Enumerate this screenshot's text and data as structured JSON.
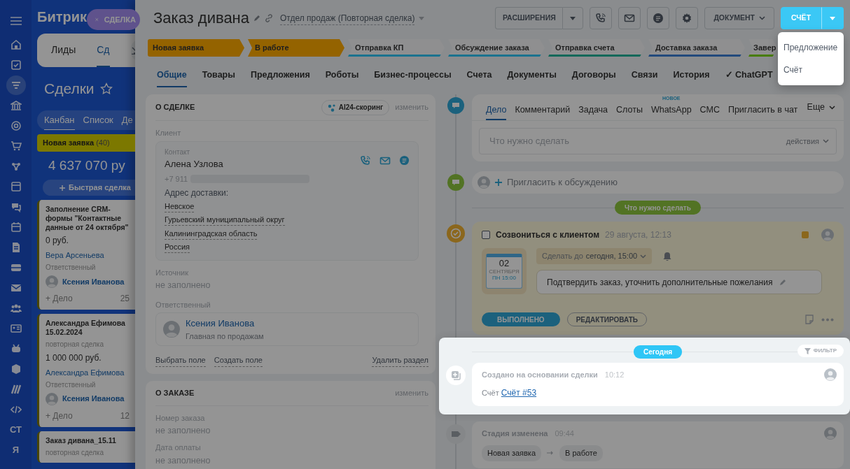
{
  "left_sidebar": {
    "labels": [
      "СТ",
      "Я"
    ]
  },
  "crm": {
    "logo": "Битрик",
    "nav_tabs": [
      {
        "label": "Лиды",
        "selected": false
      },
      {
        "label": "Сд",
        "selected": true
      }
    ],
    "page_title": "Сделки",
    "view_tabs": [
      {
        "label": "Канбан",
        "selected": true
      },
      {
        "label": "Список",
        "selected": false
      },
      {
        "label": "Де",
        "selected": false
      }
    ],
    "column": {
      "name": "Новая заявка",
      "count": "(40)",
      "color": "#7c7800",
      "total": "4 637 070 ру",
      "quick_add": "Быстрая сделка"
    },
    "cards": [
      {
        "title": "Заполнение CRM-формы \"Контактные данные от 24 октября\"",
        "amount": "0 руб.",
        "client": "Вера Арсеньева",
        "responsible_label": "Ответственный",
        "responsible": "Ксения Иванова",
        "add_task": "+ Дело",
        "meta": "25"
      },
      {
        "title": "Александра Ефимова 15.02.2024",
        "subtitle": "повторная сделка",
        "amount": "1 000 000 руб.",
        "client": "Александра Ефимова",
        "responsible_label": "Ответственный",
        "responsible": "Ксения Иванова",
        "add_task": "+ Дело",
        "meta": "12"
      },
      {
        "title": "Заказ дивана_15.11",
        "subtitle": "повторная сделка"
      }
    ]
  },
  "close_tab": {
    "label": "СДЕЛКА"
  },
  "deal": {
    "title": "Заказ дивана",
    "category": "Отдел продаж (Повторная сделка)"
  },
  "toolbar": {
    "extensions": "РАСШИРЕНИЯ",
    "document": "ДОКУМЕНТ",
    "create": "СЧЁТ",
    "menu": [
      {
        "label": "Предложение"
      },
      {
        "label": "Счёт"
      }
    ]
  },
  "stages": [
    {
      "label": "Новая заявка",
      "color": "#946300",
      "passed": true
    },
    {
      "label": "В работе",
      "color": "#946300",
      "passed": true
    },
    {
      "label": "Отправка КП",
      "color": "#1b738f",
      "passed": false
    },
    {
      "label": "Обсуждение заказа",
      "color": "#1b738f",
      "passed": false
    },
    {
      "label": "Отправка счета",
      "color": "#106859",
      "passed": false
    },
    {
      "label": "Доставка заказа",
      "color": "#224a7c",
      "passed": false
    },
    {
      "label": "Завер",
      "color": "#477c00",
      "passed": false
    }
  ],
  "tabs": [
    {
      "label": "Общие",
      "selected": true
    },
    {
      "label": "Товары",
      "selected": false
    },
    {
      "label": "Предложения",
      "selected": false
    },
    {
      "label": "Роботы",
      "selected": false
    },
    {
      "label": "Бизнес-процессы",
      "selected": false
    },
    {
      "label": "Счета",
      "selected": false
    },
    {
      "label": "Документы",
      "selected": false
    },
    {
      "label": "Договоры",
      "selected": false
    },
    {
      "label": "Связи",
      "selected": false
    },
    {
      "label": "История",
      "selected": false
    },
    {
      "label": "✓ ChatGPT",
      "selected": false
    }
  ],
  "about": {
    "title": "О СДЕЛКЕ",
    "scoring": "AI24-скоринг",
    "edit": "изменить",
    "client_label": "Клиент",
    "contact_label": "Контакт",
    "contact_name": "Алена Узлова",
    "phone": "+7 911",
    "address_label": "Адрес доставки:",
    "address": [
      "Невское",
      "Гурьевский муниципальный округ",
      "Калининградская область",
      "Россия"
    ],
    "source_label": "Источник",
    "source_value": "не заполнено",
    "responsible_label": "Ответственный",
    "responsible_name": "Ксения Иванова",
    "responsible_role": "Главная по продажам",
    "links": [
      "Выбрать поле",
      "Создать поле"
    ],
    "delete": "Удалить раздел"
  },
  "order": {
    "title": "О ЗАКАЗЕ",
    "edit": "изменить",
    "fields": [
      {
        "label": "Номер заказа",
        "value": "не заполнено"
      },
      {
        "label": "Дата оплаты",
        "value": "не заполнено"
      }
    ]
  },
  "timeline": {
    "composer": {
      "tabs": [
        {
          "label": "Дело",
          "selected": true
        },
        {
          "label": "Комментарий",
          "selected": false
        },
        {
          "label": "Задача",
          "selected": false
        },
        {
          "label": "Слоты",
          "selected": false
        },
        {
          "label": "WhatsApp",
          "selected": false,
          "badge": "НОВОЕ"
        },
        {
          "label": "СМС",
          "selected": false
        },
        {
          "label": "Пригласить в чат",
          "selected": false
        }
      ],
      "more": "Еще",
      "placeholder": "Что нужно сделать",
      "actions": "действия"
    },
    "invite": "Пригласить к обсуждению",
    "todo_label": "Что нужно сделать",
    "activity": {
      "checked": false,
      "title": "Созвониться с клиентом",
      "time": "29 августа, 12:13",
      "day": "02",
      "month": "СЕНТЯБРЯ",
      "weekday": "ПН 15:00",
      "deadline_prefix": "Сделать до",
      "deadline": "сегодня, 15:00",
      "note": "Подтвердить заказ, уточнить дополнительные пожелания",
      "done": "ВЫПОЛНЕНО",
      "edit": "РЕДАКТИРОВАТЬ"
    },
    "today": "Сегодня",
    "filter": "ФИЛЬТР",
    "events": [
      {
        "kind": "created",
        "highlighted": true,
        "title": "Создано на основании сделки",
        "time": "10:12",
        "label": "Счёт",
        "link": "Счёт #53"
      },
      {
        "kind": "stage",
        "highlighted": false,
        "title": "Стадия изменена",
        "time": "09:44",
        "from": "Новая заявка",
        "to": "В работе"
      }
    ]
  }
}
